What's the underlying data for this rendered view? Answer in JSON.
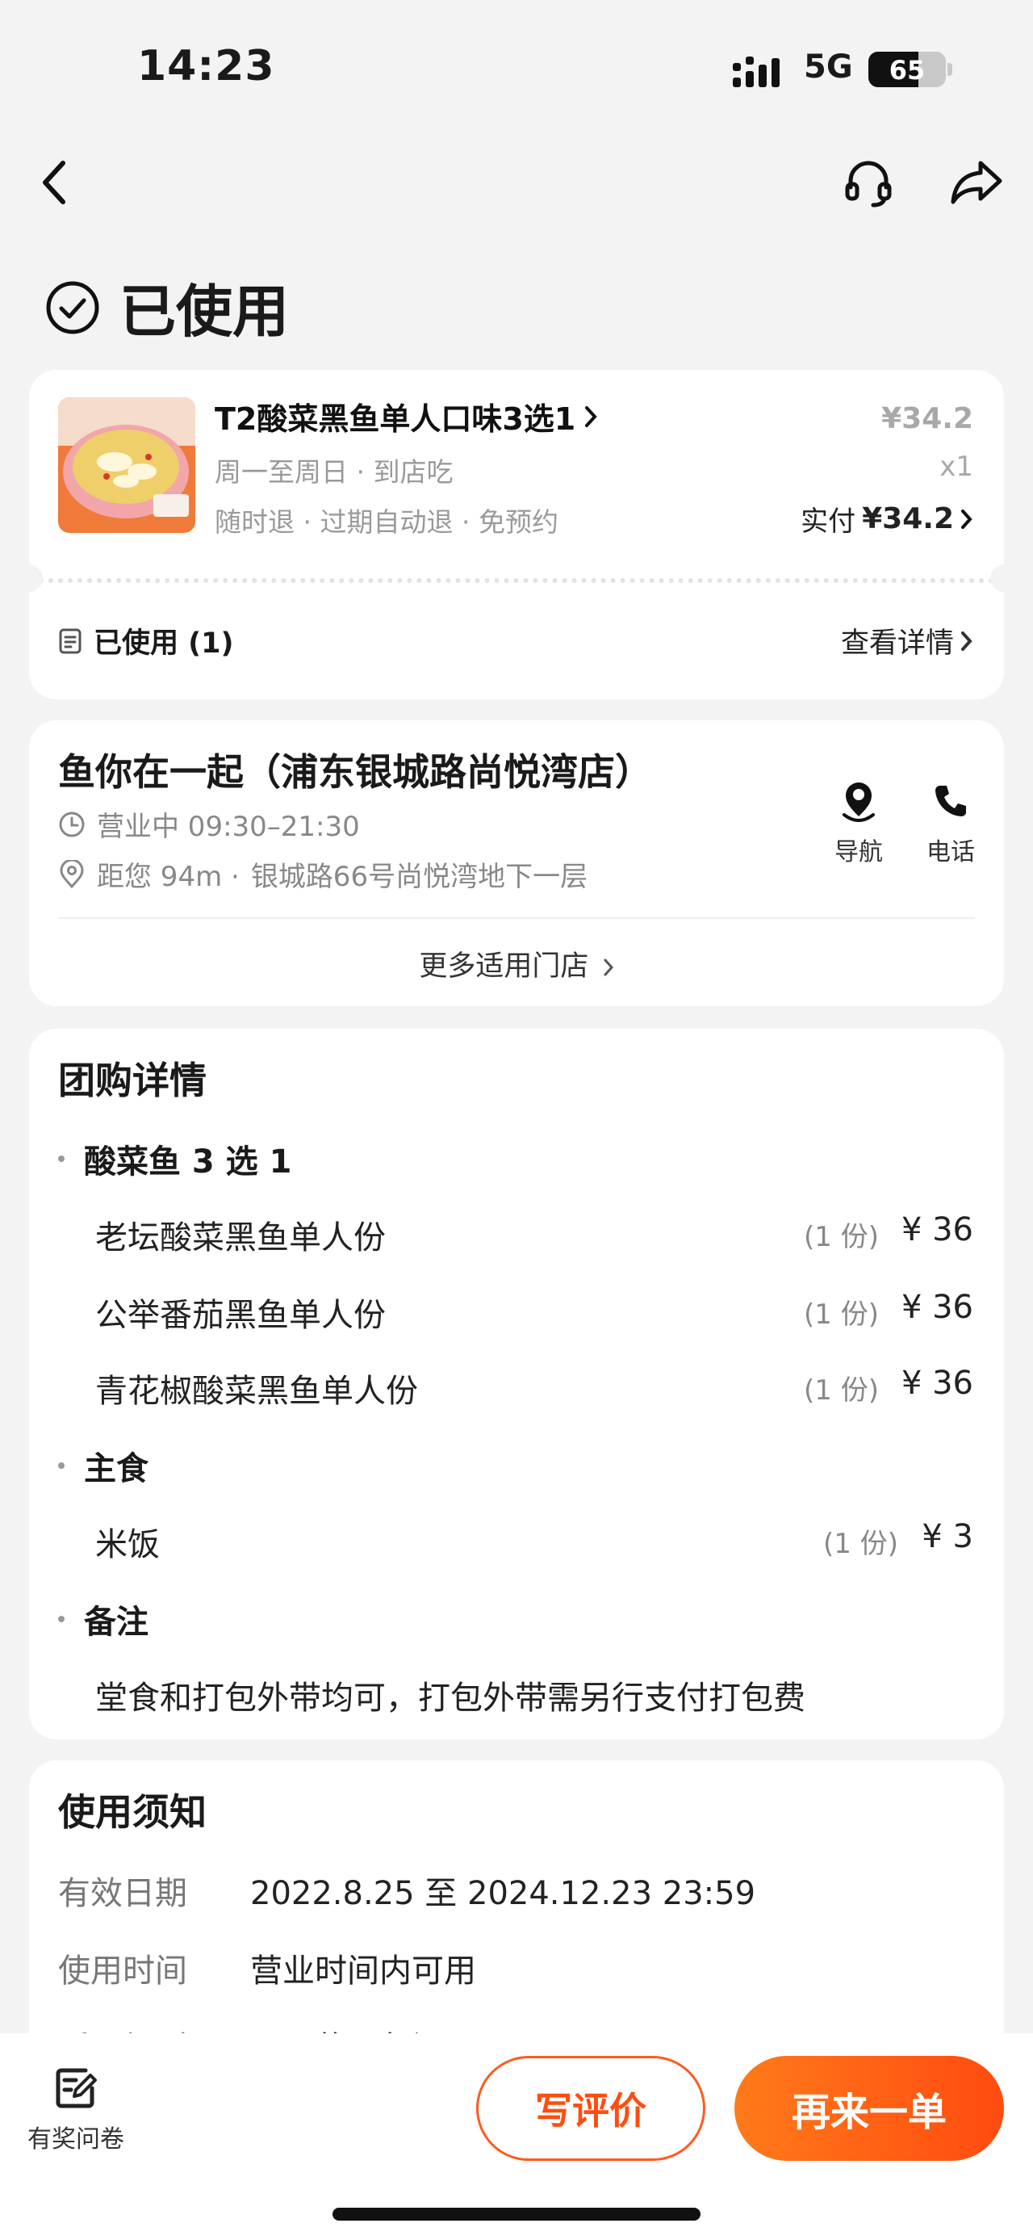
{
  "status_bar": {
    "time": "14:23",
    "network": "5G",
    "battery": "65",
    "battery_level": 0.65
  },
  "order_status": "已使用",
  "deal": {
    "title": "T2酸菜黑鱼单人口味3选1",
    "schedule": "周一至周日 · 到店吃",
    "policies": "随时退 · 过期自动退 · 免预约",
    "original_price": "¥34.2",
    "quantity": "x1",
    "paid_label": "实付",
    "paid_amount": "¥34.2",
    "used_label": "已使用 (1)",
    "view_detail": "查看详情"
  },
  "store": {
    "name": "鱼你在一起（浦东银城路尚悦湾店）",
    "hours": "营业中 09:30–21:30",
    "distance": "距您 94m ·",
    "address": "银城路66号尚悦湾地下一层",
    "nav_label": "导航",
    "phone_label": "电话",
    "more_stores": "更多适用门店"
  },
  "group_detail": {
    "title": "团购详情",
    "groups": [
      {
        "name": "酸菜鱼 3 选 1",
        "items": [
          {
            "name": "老坛酸菜黑鱼单人份",
            "count": "(1 份)",
            "price": "¥ 36"
          },
          {
            "name": "公举番茄黑鱼单人份",
            "count": "(1 份)",
            "price": "¥ 36"
          },
          {
            "name": "青花椒酸菜黑鱼单人份",
            "count": "(1 份)",
            "price": "¥ 36"
          }
        ]
      },
      {
        "name": "主食",
        "items": [
          {
            "name": "米饭",
            "count": "(1 份)",
            "price": "¥ 3"
          }
        ]
      },
      {
        "name": "备注",
        "note": "堂食和打包外带均可，打包外带需另行支付打包费"
      }
    ]
  },
  "usage": {
    "title": "使用须知",
    "rows": [
      {
        "key": "有效日期",
        "value": "2022.8.25 至 2024.12.23 23:59"
      },
      {
        "key": "使用时间",
        "value": "营业时间内可用"
      },
      {
        "key": "适用规则",
        "value": "不可使用包间"
      }
    ]
  },
  "bottom_bar": {
    "survey": "有奖问卷",
    "review": "写评价",
    "reorder": "再来一单"
  },
  "colors": {
    "accent": "#ff5a1f",
    "background": "#f3f3f3"
  }
}
